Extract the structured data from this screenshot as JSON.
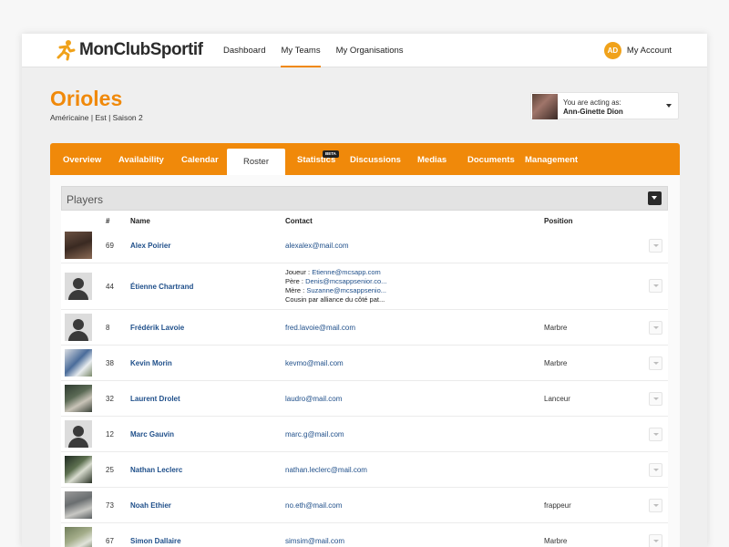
{
  "brand": {
    "name": "MonClubSportif",
    "accent": "#f0890a",
    "logo_icon": "runner-icon"
  },
  "nav": {
    "items": [
      "Dashboard",
      "My Teams",
      "My Organisations"
    ],
    "active": "My Teams"
  },
  "account": {
    "initials": "AD",
    "label": "My Account"
  },
  "team": {
    "name": "Orioles",
    "subtitle": "Américaine | Est | Saison 2"
  },
  "acting": {
    "line1": "You are acting as:",
    "line2": "Ann-Ginette Dion"
  },
  "tabs": {
    "items": [
      "Overview",
      "Availability",
      "Calendar",
      "Roster",
      "Statistics",
      "Discussions",
      "Medias",
      "Documents",
      "Management"
    ],
    "active": "Roster",
    "beta_label": "BETA"
  },
  "players": {
    "title": "Players",
    "columns": {
      "number": "#",
      "name": "Name",
      "contact": "Contact",
      "position": "Position"
    },
    "rows": [
      {
        "number": "69",
        "name": "Alex Poirier",
        "email": "alexalex@mail.com",
        "position": ""
      },
      {
        "number": "44",
        "name": "Étienne Chartrand",
        "contact_lines": [
          {
            "label": "Joueur : ",
            "link": "Etienne@mcsapp.com"
          },
          {
            "label": "Père : ",
            "link": "Denis@mcsappsenior.co..."
          },
          {
            "label": "Mère : ",
            "link": "Suzanne@mcsappsenio..."
          },
          {
            "label": "Cousin par alliance du côté pat...",
            "link": ""
          }
        ],
        "position": ""
      },
      {
        "number": "8",
        "name": "Frédérik Lavoie",
        "email": "fred.lavoie@mail.com",
        "position": "Marbre"
      },
      {
        "number": "38",
        "name": "Kevin Morin",
        "email": "kevmo@mail.com",
        "position": "Marbre"
      },
      {
        "number": "32",
        "name": "Laurent Drolet",
        "email": "laudro@mail.com",
        "position": "Lanceur"
      },
      {
        "number": "12",
        "name": "Marc Gauvin",
        "email": "marc.g@mail.com",
        "position": ""
      },
      {
        "number": "25",
        "name": "Nathan Leclerc",
        "email": "nathan.leclerc@mail.com",
        "position": ""
      },
      {
        "number": "73",
        "name": "Noah Ethier",
        "email": "no.eth@mail.com",
        "position": "frappeur"
      },
      {
        "number": "67",
        "name": "Simon Dallaire",
        "email": "simsim@mail.com",
        "position": "Marbre"
      }
    ]
  }
}
